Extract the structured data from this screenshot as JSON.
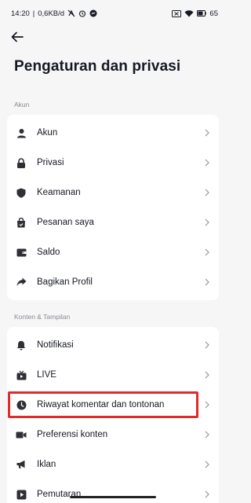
{
  "status_bar": {
    "time": "14:20",
    "network_speed": "0,6KB/d",
    "battery": "65"
  },
  "header": {
    "back_icon": "arrow-left-icon",
    "title": "Pengaturan dan privasi"
  },
  "sections": [
    {
      "header": "Akun",
      "items": [
        {
          "label": "Akun",
          "icon": "person-icon"
        },
        {
          "label": "Privasi",
          "icon": "lock-icon"
        },
        {
          "label": "Keamanan",
          "icon": "shield-icon"
        },
        {
          "label": "Pesanan saya",
          "icon": "shopping-bag-icon"
        },
        {
          "label": "Saldo",
          "icon": "wallet-icon"
        },
        {
          "label": "Bagikan Profil",
          "icon": "share-icon"
        }
      ]
    },
    {
      "header": "Konten & Tampilan",
      "items": [
        {
          "label": "Notifikasi",
          "icon": "bell-icon"
        },
        {
          "label": "LIVE",
          "icon": "live-icon"
        },
        {
          "label": "Riwayat komentar dan tontonan",
          "icon": "clock-icon",
          "highlighted": true
        },
        {
          "label": "Preferensi konten",
          "icon": "video-camera-icon"
        },
        {
          "label": "Iklan",
          "icon": "megaphone-icon"
        },
        {
          "label": "Pemutaran",
          "icon": "play-icon"
        }
      ]
    }
  ],
  "colors": {
    "highlight": "#e02b2b",
    "background": "#f6f6f7",
    "text": "#161823",
    "muted": "#8a8b91"
  }
}
